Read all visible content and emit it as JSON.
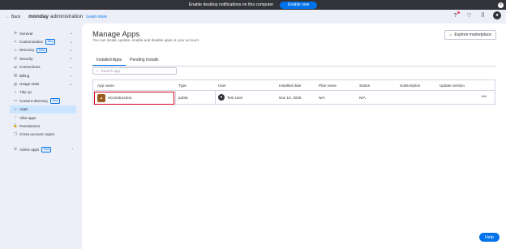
{
  "notification": {
    "text": "Enable desktop notifications on this computer",
    "button": "Enable now"
  },
  "header": {
    "back": "Back",
    "brand_bold": "monday",
    "brand_rest": " administration",
    "learn_more": "Learn more"
  },
  "sidebar": {
    "items": [
      {
        "label": "General",
        "icon": "gear-icon",
        "glyph": "⚙",
        "chevron": true,
        "badge": ""
      },
      {
        "label": "Customization",
        "icon": "brush-icon",
        "glyph": "✎",
        "chevron": true,
        "badge": "New"
      },
      {
        "label": "Directory",
        "icon": "people-icon",
        "glyph": "☺",
        "chevron": true,
        "badge": "New"
      },
      {
        "label": "Security",
        "icon": "shield-icon",
        "glyph": "⛨",
        "chevron": true,
        "badge": ""
      },
      {
        "label": "Connections",
        "icon": "connections-icon",
        "glyph": "⇄",
        "chevron": true,
        "badge": ""
      },
      {
        "label": "Billing",
        "icon": "billing-icon",
        "glyph": "▤",
        "chevron": true,
        "badge": ""
      },
      {
        "label": "Usage stats",
        "icon": "chart-icon",
        "glyph": "▥",
        "chevron": true,
        "badge": ""
      },
      {
        "label": "Tidy up",
        "icon": "tidy-icon",
        "glyph": "✧",
        "chevron": false,
        "badge": ""
      },
      {
        "label": "Content directory",
        "icon": "folder-icon",
        "glyph": "▭",
        "chevron": false,
        "badge": "New"
      },
      {
        "label": "Apps",
        "icon": "apps-icon",
        "glyph": "◇",
        "chevron": false,
        "badge": ""
      },
      {
        "label": "Vibe apps",
        "icon": "heart-icon",
        "glyph": "♡",
        "chevron": false,
        "badge": ""
      },
      {
        "label": "Permissions",
        "icon": "lock-icon",
        "glyph": "🔒",
        "chevron": false,
        "badge": ""
      },
      {
        "label": "Cross account copier",
        "icon": "copy-icon",
        "glyph": "❐",
        "chevron": false,
        "badge": ""
      }
    ],
    "admin_apps": {
      "label": "Admin apps",
      "badge": "New"
    }
  },
  "main": {
    "title": "Manage Apps",
    "subtitle": "You can install, update, enable and disable apps in your account",
    "explore_button": "Explore marketplace",
    "tabs": [
      {
        "label": "Installed Apps"
      },
      {
        "label": "Pending Installs"
      }
    ],
    "search_placeholder": "Search app",
    "columns": [
      "App name",
      "Type",
      "User",
      "Installed date",
      "Plan name",
      "Status",
      "Subscription",
      "Update version"
    ],
    "rows": [
      {
        "app_name": "eConstruction",
        "type": "public",
        "user": "Test User",
        "installed_date": "Nov 10, 2025",
        "plan_name": "N/A",
        "status": "N/A",
        "subscription": "",
        "update_version": ""
      }
    ]
  },
  "help_button": "Help",
  "colors": {
    "accent": "#0073ea",
    "highlight": "#d0021b",
    "active_bg": "#cce5ff"
  }
}
